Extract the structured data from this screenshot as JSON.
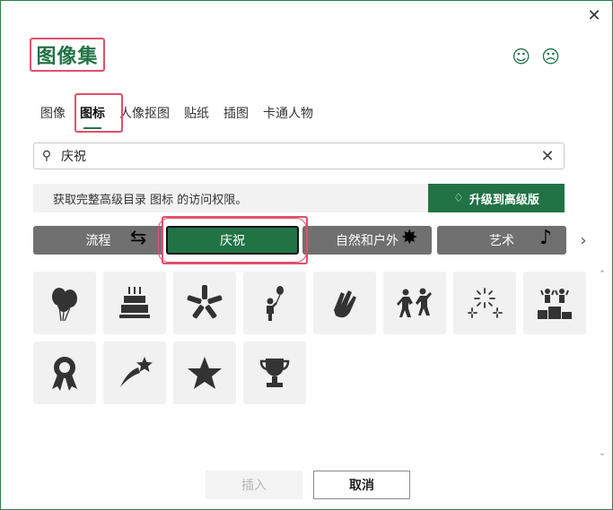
{
  "dialog": {
    "title": "图像集",
    "close_glyph": "✕",
    "feedback": {
      "happy_glyph": "☺",
      "sad_glyph": "☹"
    }
  },
  "tabs": [
    {
      "label": "图像",
      "active": false
    },
    {
      "label": "图标",
      "active": true
    },
    {
      "label": "人像抠图",
      "active": false
    },
    {
      "label": "贴纸",
      "active": false
    },
    {
      "label": "插图",
      "active": false
    },
    {
      "label": "卡通人物",
      "active": false
    }
  ],
  "search": {
    "value": "庆祝",
    "placeholder": "",
    "search_glyph": "⚲",
    "clear_glyph": "✕"
  },
  "upsell": {
    "message": "获取完整高级目录 图标 的访问权限。",
    "upgrade_label": "升级到高级版",
    "upgrade_glyph": "♢"
  },
  "categories": [
    {
      "label": "流程",
      "deco": "⇆",
      "active": false
    },
    {
      "label": "庆祝",
      "deco": "",
      "active": true
    },
    {
      "label": "自然和户外",
      "deco": "✸",
      "active": false
    },
    {
      "label": "艺术",
      "deco": "♪",
      "active": false
    }
  ],
  "next_glyph": "›",
  "icons": [
    "balloons-icon",
    "birthday-cake-icon",
    "team-hands-icon",
    "person-with-balloon-icon",
    "clapping-hands-icon",
    "dancing-people-icon",
    "fireworks-icon",
    "podium-icon",
    "award-ribbon-icon",
    "shooting-star-icon",
    "star-icon",
    "trophy-icon"
  ],
  "scroll": {
    "up_glyph": "⌃",
    "down_glyph": "⌄"
  },
  "actions": {
    "insert_label": "插入",
    "cancel_label": "取消"
  },
  "colors": {
    "accent": "#217346",
    "highlight": "#e0506a",
    "category_bg": "#707070",
    "tile_bg": "#f1f1f1"
  }
}
